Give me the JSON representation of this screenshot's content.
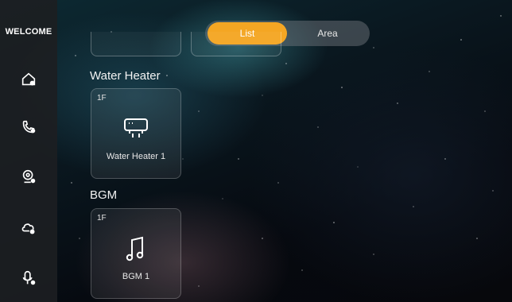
{
  "sidebar": {
    "brand": "WELCOME",
    "items": [
      {
        "icon": "home-settings-icon"
      },
      {
        "icon": "phone-call-icon"
      },
      {
        "icon": "camera-monitor-icon"
      },
      {
        "icon": "cloud-settings-icon"
      },
      {
        "icon": "microphone-icon"
      }
    ]
  },
  "view_switch": {
    "list_label": "List",
    "area_label": "Area",
    "selected": "List",
    "accent_color": "#f4a623"
  },
  "sections": [
    {
      "title": "Water Heater",
      "devices": [
        {
          "floor": "1F",
          "name": "Water Heater 1",
          "icon": "water-heater-icon"
        }
      ]
    },
    {
      "title": "BGM",
      "devices": [
        {
          "floor": "1F",
          "name": "BGM 1",
          "icon": "music-note-icon"
        }
      ]
    }
  ]
}
